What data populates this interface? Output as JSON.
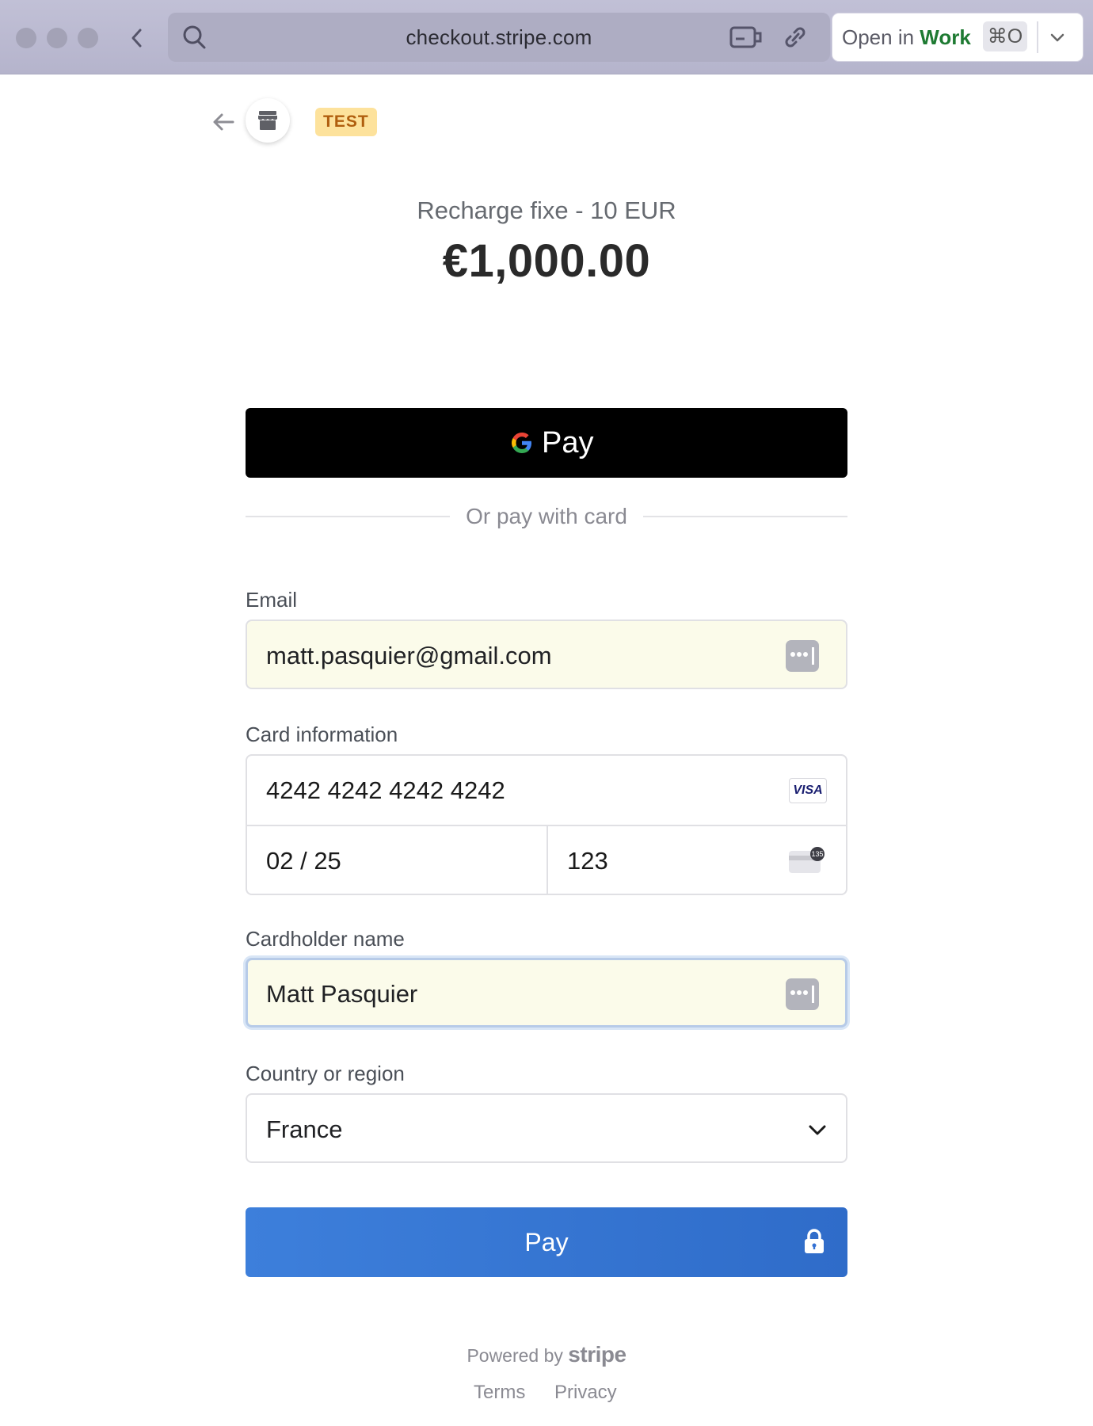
{
  "browser": {
    "url": "checkout.stripe.com",
    "open_in_prefix": "Open in ",
    "open_in_target": "Work",
    "shortcut": "⌘O"
  },
  "checkout": {
    "test_badge": "TEST",
    "product_name": "Recharge fixe - 10 EUR",
    "amount": "€1,000.00",
    "gpay_label": "Pay",
    "divider_text": "Or pay with card",
    "email": {
      "label": "Email",
      "value": "matt.pasquier@gmail.com"
    },
    "card": {
      "label": "Card information",
      "number": "4242 4242 4242 4242",
      "expiry": "02 / 25",
      "cvc": "123",
      "brand": "VISA",
      "cvc_hint": "135"
    },
    "cardholder": {
      "label": "Cardholder name",
      "value": "Matt Pasquier"
    },
    "country": {
      "label": "Country or region",
      "value": "France"
    },
    "pay_label": "Pay",
    "powered_by": "Powered by",
    "powered_brand": "stripe",
    "footer": {
      "terms": "Terms",
      "privacy": "Privacy"
    }
  },
  "colors": {
    "pay_button": "#3371d4",
    "autofill_bg": "#fbfbea",
    "test_badge_bg": "#fde29c",
    "open_in_work": "#1e7a32"
  }
}
